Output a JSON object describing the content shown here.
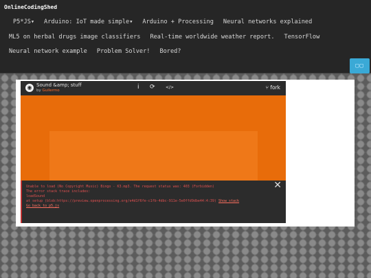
{
  "header": {
    "brand": "OnlineCodingShed",
    "nav_row1": [
      "P5*JS▾",
      "Arduino: IoT made simple▾",
      "Arduino + Processing",
      "Neural networks explained"
    ],
    "nav_row2": [
      "ML5 on herbal drugs image classifiers",
      "Real-time worldwide weather report.",
      "TensorFlow"
    ],
    "nav_row3": [
      "Neural network example",
      "Problem Solver!",
      "Bored?"
    ],
    "toggle_label": "▢▢"
  },
  "editor": {
    "title": "Sound &amp; stuff",
    "author_prefix": "by",
    "author": "Guilermo",
    "fork_label": "fork",
    "info_icon": "i",
    "play_icon": "⟳",
    "code_icon": "</>",
    "close_icon": "✕"
  },
  "console": {
    "lines": [
      "Unable to load (No Copyright Music) Bingo - K3.mp3. The request status was: 403 (Forbidden)",
      "The error stack trace includes:",
      "loadSound",
      "at setup (blob:https://preview.openprocessing.org/e4d1f6fe-c1fb-4dbc-911e-5e0ffd9dbe44:4:39)"
    ],
    "link1": "Show stack",
    "link2": "Go back to p5.js"
  },
  "colors": {
    "canvas": "#e86c0a",
    "accent": "#3aa9d6",
    "error": "#e05050"
  }
}
